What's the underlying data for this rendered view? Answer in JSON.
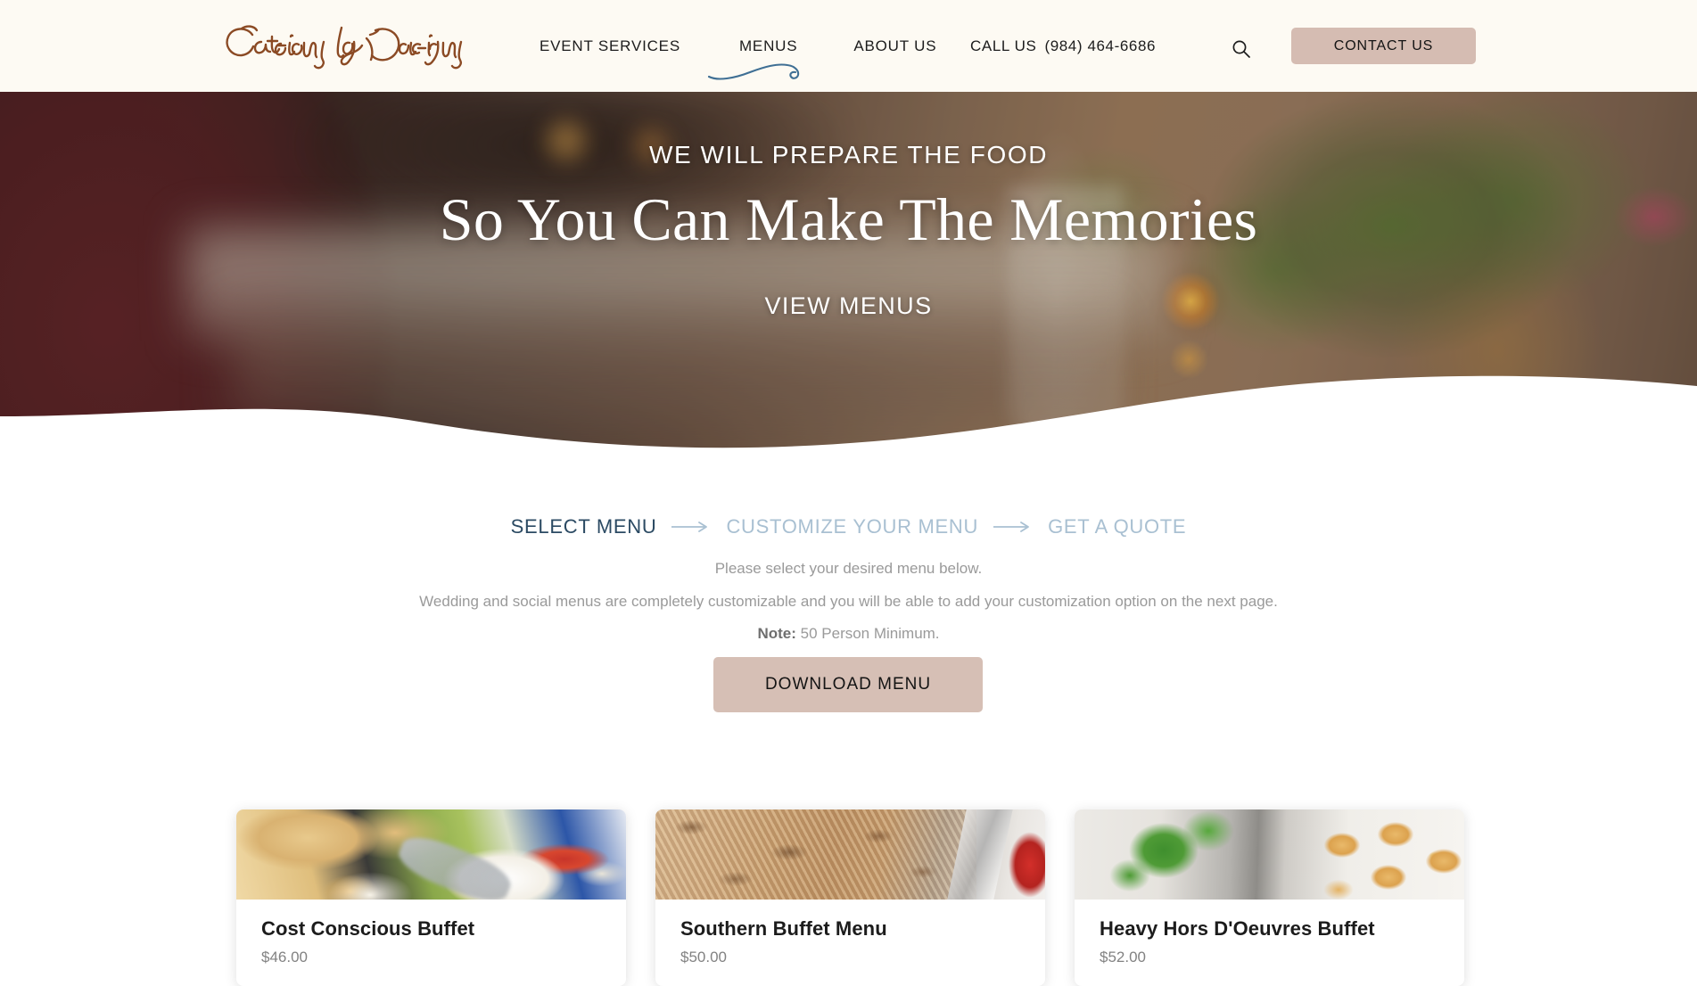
{
  "header": {
    "logo_text": "Catering by Design",
    "logo_icon": "script-wordmark-logo",
    "nav": [
      {
        "label": "EVENT SERVICES",
        "active": false
      },
      {
        "label": "MENUS",
        "active": true
      },
      {
        "label": "ABOUT US",
        "active": false
      }
    ],
    "call": {
      "label": "CALL US",
      "phone": "(984) 464-6686"
    },
    "search_icon": "search-icon",
    "contact_button": "CONTACT US",
    "colors": {
      "header_bg": "#fdfaf3",
      "button_bg": "#d5bcb2",
      "logo_brown": "#8b4a24",
      "swirl_blue": "#3f6f94"
    }
  },
  "hero": {
    "eyebrow": "WE WILL PREPARE THE FOOD",
    "title": "So You Can Make The Memories",
    "cta": "VIEW MENUS"
  },
  "steps": {
    "items": [
      {
        "label": "SELECT MENU",
        "state": "active"
      },
      {
        "label": "CUSTOMIZE YOUR MENU",
        "state": "inactive"
      },
      {
        "label": "GET A QUOTE",
        "state": "inactive"
      }
    ],
    "arrow_icon": "arrow-right-icon",
    "active_color": "#2b4a63",
    "inactive_color": "#a9c0d2"
  },
  "description": {
    "line1": "Please select your desired menu below.",
    "line2": "Wedding and social menus are completely customizable and you will be able to add your customization option on the next page.",
    "note_label": "Note:",
    "note_text": "50 Person Minimum."
  },
  "download_button": {
    "label": "DOWNLOAD MENU",
    "bg": "#d6bfb5"
  },
  "menu_cards": [
    {
      "title": "Cost Conscious Buffet",
      "price": "$46.00",
      "image_alt": "buffet-spread-photo"
    },
    {
      "title": "Southern Buffet Menu",
      "price": "$50.00",
      "image_alt": "pulled-pork-pan-photo"
    },
    {
      "title": "Heavy Hors D'Oeuvres Buffet",
      "price": "$52.00",
      "image_alt": "hors-doeuvres-tartlets-photo"
    }
  ]
}
